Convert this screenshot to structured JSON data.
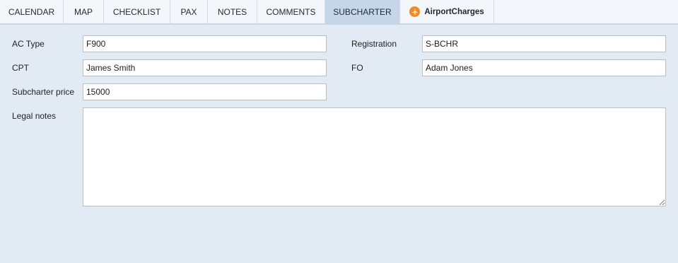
{
  "tabs": [
    {
      "label": "CALENDAR",
      "active": false
    },
    {
      "label": "MAP",
      "active": false
    },
    {
      "label": "CHECKLIST",
      "active": false
    },
    {
      "label": "PAX",
      "active": false
    },
    {
      "label": "NOTES",
      "active": false
    },
    {
      "label": "COMMENTS",
      "active": false
    },
    {
      "label": "SUBCHARTER",
      "active": true
    },
    {
      "label": "AirportCharges",
      "active": false,
      "icon": "airportcharges-logo-icon"
    }
  ],
  "form": {
    "ac_type": {
      "label": "AC Type",
      "value": "F900"
    },
    "registration": {
      "label": "Registration",
      "value": "S-BCHR"
    },
    "cpt": {
      "label": "CPT",
      "value": "James Smith"
    },
    "fo": {
      "label": "FO",
      "value": "Adam Jones"
    },
    "subcharter_price": {
      "label": "Subcharter price",
      "value": "15000"
    },
    "legal_notes": {
      "label": "Legal notes",
      "value": ""
    }
  },
  "colors": {
    "background": "#e2eaf4",
    "active_tab": "#c6d5e8",
    "logo_orange": "#f08a24"
  }
}
